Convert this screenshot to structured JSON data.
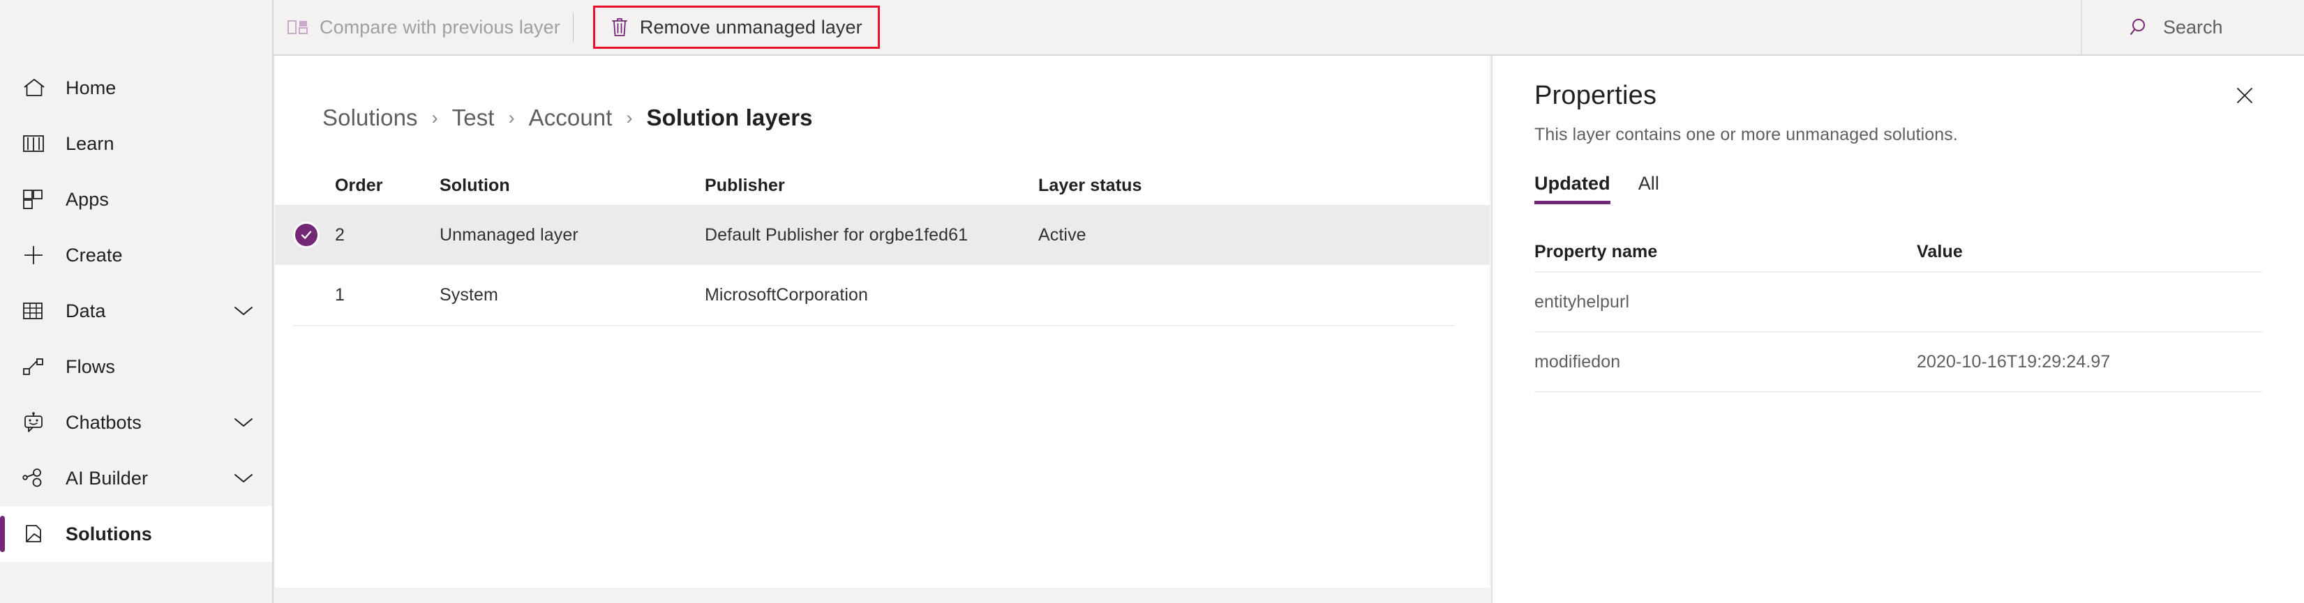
{
  "colors": {
    "accent_purple": "#742774",
    "highlight_red": "#e8112d",
    "sidebar_bg": "#f3f2f1",
    "selected_row_bg": "#ebebeb",
    "text_primary": "#201f1e",
    "text_secondary": "#605e5c",
    "text_disabled": "#a19f9d"
  },
  "topbar": {
    "menu_icon": "hamburger-icon",
    "commands": [
      {
        "id": "compare-with-previous-layer",
        "label": "Compare with previous layer",
        "icon": "compare-layers-icon",
        "disabled": true,
        "highlighted": false
      },
      {
        "id": "remove-unmanaged-layer",
        "label": "Remove unmanaged layer",
        "icon": "trash-icon",
        "disabled": false,
        "highlighted": true
      }
    ],
    "search": {
      "label": "Search",
      "icon": "search-icon"
    }
  },
  "sidebar": {
    "items": [
      {
        "label": "Home",
        "icon": "home-icon",
        "chevron": false,
        "selected": false
      },
      {
        "label": "Learn",
        "icon": "book-icon",
        "chevron": false,
        "selected": false
      },
      {
        "label": "Apps",
        "icon": "apps-grid-icon",
        "chevron": false,
        "selected": false
      },
      {
        "label": "Create",
        "icon": "plus-icon",
        "chevron": false,
        "selected": false
      },
      {
        "label": "Data",
        "icon": "table-icon",
        "chevron": true,
        "selected": false
      },
      {
        "label": "Flows",
        "icon": "flows-icon",
        "chevron": false,
        "selected": false
      },
      {
        "label": "Chatbots",
        "icon": "chatbot-icon",
        "chevron": true,
        "selected": false
      },
      {
        "label": "AI Builder",
        "icon": "ai-builder-icon",
        "chevron": true,
        "selected": false
      },
      {
        "label": "Solutions",
        "icon": "solutions-icon",
        "chevron": false,
        "selected": true
      }
    ]
  },
  "main": {
    "breadcrumb": [
      {
        "label": "Solutions",
        "current": false
      },
      {
        "label": "Test",
        "current": false
      },
      {
        "label": "Account",
        "current": false
      },
      {
        "label": "Solution layers",
        "current": true
      }
    ],
    "breadcrumb_separator": "›",
    "table": {
      "columns": [
        "Order",
        "Solution",
        "Publisher",
        "Layer status"
      ],
      "rows": [
        {
          "selected": true,
          "order": "2",
          "solution": "Unmanaged layer",
          "publisher": "Default Publisher for orgbe1fed61",
          "layer_status": "Active"
        },
        {
          "selected": false,
          "order": "1",
          "solution": "System",
          "publisher": "MicrosoftCorporation",
          "layer_status": ""
        }
      ]
    }
  },
  "panel": {
    "title": "Properties",
    "subtitle": "This layer contains one or more unmanaged solutions.",
    "close_icon": "close-icon",
    "tabs": [
      {
        "label": "Updated",
        "active": true
      },
      {
        "label": "All",
        "active": false
      }
    ],
    "table": {
      "columns": [
        "Property name",
        "Value"
      ],
      "rows": [
        {
          "name": "entityhelpurl",
          "value": ""
        },
        {
          "name": "modifiedon",
          "value": "2020-10-16T19:29:24.97"
        }
      ]
    }
  }
}
